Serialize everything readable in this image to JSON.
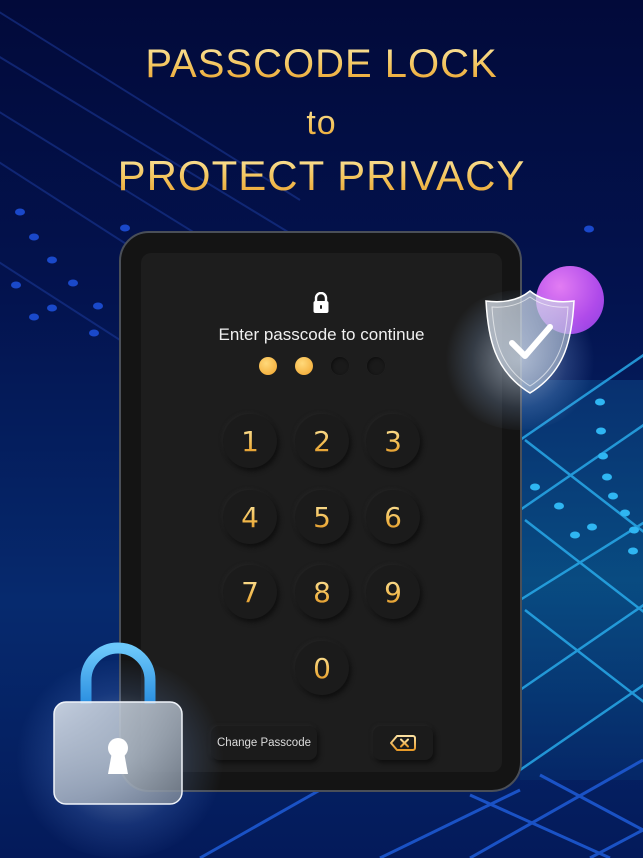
{
  "headline": {
    "line1": "PASSCODE LOCK",
    "line2": "to",
    "line3": "PROTECT PRIVACY"
  },
  "lock_screen": {
    "lock_icon": "lock-icon",
    "prompt": "Enter passcode to continue",
    "passcode_length": 4,
    "digits_entered": 2,
    "keys": [
      "1",
      "2",
      "3",
      "4",
      "5",
      "6",
      "7",
      "8",
      "9",
      "0"
    ],
    "change_passcode_label": "Change Passcode",
    "backspace_icon": "backspace-icon"
  },
  "decorations": {
    "shield_icon": "shield-check-icon",
    "padlock_icon": "padlock-icon"
  },
  "colors": {
    "background": "#03134f",
    "gold": "#f2b84a",
    "panel": "#1d1d1d",
    "accent_purple": "#c060ee",
    "accent_blue": "#4ab0f0"
  }
}
